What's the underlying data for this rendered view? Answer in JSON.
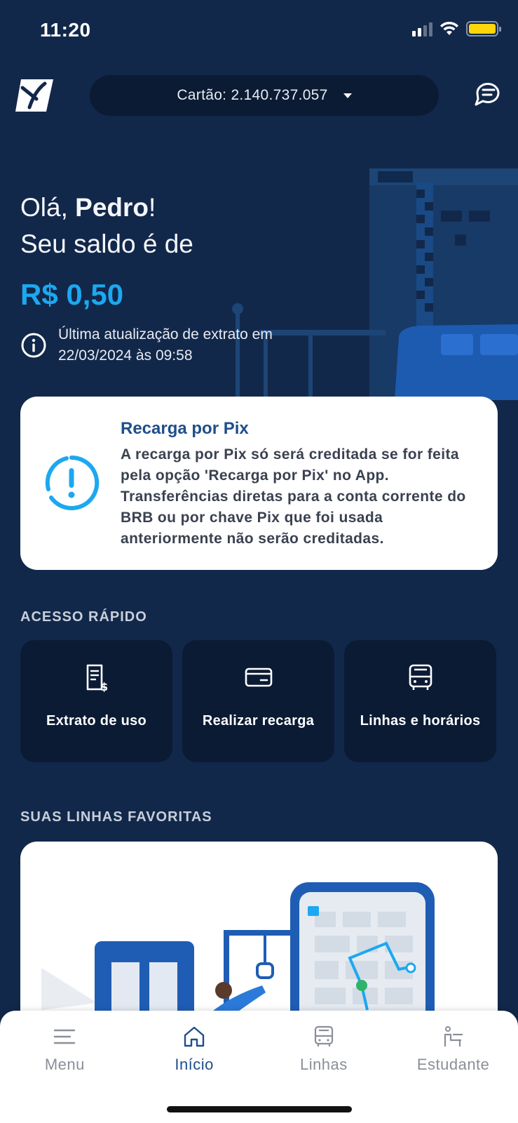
{
  "status_bar": {
    "time": "11:20"
  },
  "header": {
    "card_label": "Cartão: 2.140.737.057"
  },
  "greeting": {
    "hello": "Olá,",
    "name": "Pedro",
    "exclaim": "!",
    "balance_intro": "Seu saldo é de",
    "balance": "R$ 0,50",
    "update_line1": "Última atualização de extrato em",
    "update_line2": "22/03/2024 às 09:58"
  },
  "pix_notice": {
    "title": "Recarga por Pix",
    "body": "A recarga por Pix só será creditada se for feita pela opção 'Recarga por Pix' no App. Transferências diretas para a conta corrente do BRB ou por chave Pix que foi usada anteriormente não serão creditadas."
  },
  "quick_access": {
    "title": "ACESSO RÁPIDO",
    "items": [
      {
        "label": "Extrato de uso",
        "icon": "receipt-dollar-icon"
      },
      {
        "label": "Realizar recarga",
        "icon": "credit-card-icon"
      },
      {
        "label": "Linhas e horários",
        "icon": "bus-icon"
      }
    ]
  },
  "favorites": {
    "title": "SUAS LINHAS FAVORITAS"
  },
  "bottom_nav": {
    "items": [
      {
        "label": "Menu",
        "icon": "hamburger-icon"
      },
      {
        "label": "Início",
        "icon": "home-icon"
      },
      {
        "label": "Linhas",
        "icon": "bus-icon"
      },
      {
        "label": "Estudante",
        "icon": "student-icon"
      }
    ],
    "active": "Início"
  },
  "colors": {
    "background": "#12284a",
    "accent": "#1ca8f0",
    "tile": "#0b1b34",
    "pix_title": "#1f4e8a",
    "battery": "#ffd60a"
  }
}
